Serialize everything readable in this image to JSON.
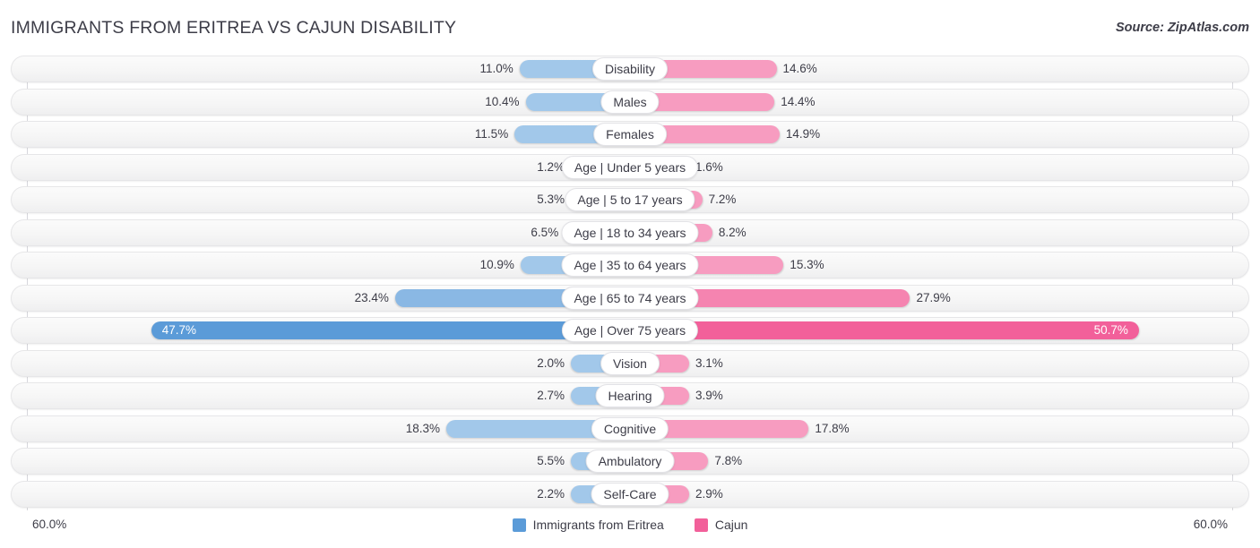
{
  "header": {
    "title": "IMMIGRANTS FROM ERITREA VS CAJUN DISABILITY",
    "source": "Source: ZipAtlas.com"
  },
  "axis": {
    "left_label": "60.0%",
    "right_label": "60.0%"
  },
  "legend": {
    "items": [
      {
        "label": "Immigrants from Eritrea",
        "color": "#5b9bd8"
      },
      {
        "label": "Cajun",
        "color": "#f2609a"
      }
    ]
  },
  "colors": {
    "blue_light": "#a2c8ea",
    "blue_mid": "#8ab8e4",
    "blue_dark": "#5b9bd8",
    "pink_light": "#f79cc0",
    "pink_mid": "#f584b0",
    "pink_dark": "#f2609a",
    "track": "#f6f6f6",
    "gridline": "#d7d7dc"
  },
  "chart_data": {
    "type": "bar",
    "subtype": "diverging-bidirectional",
    "title": "IMMIGRANTS FROM ERITREA VS CAJUN DISABILITY",
    "xlabel": "",
    "ylabel": "",
    "xlim": [
      60.0,
      60.0
    ],
    "axis_max_percent": 60.0,
    "grid": true,
    "legend_position": "bottom-center",
    "categories": [
      "Disability",
      "Males",
      "Females",
      "Age | Under 5 years",
      "Age | 5 to 17 years",
      "Age | 18 to 34 years",
      "Age | 35 to 64 years",
      "Age | 65 to 74 years",
      "Age | Over 75 years",
      "Vision",
      "Hearing",
      "Cognitive",
      "Ambulatory",
      "Self-Care"
    ],
    "series": [
      {
        "name": "Immigrants from Eritrea",
        "color": "#5b9bd8",
        "values": [
          11.0,
          10.4,
          11.5,
          1.2,
          5.3,
          6.5,
          10.9,
          23.4,
          47.7,
          2.0,
          2.7,
          18.3,
          5.5,
          2.2
        ],
        "labels": [
          "11.0%",
          "10.4%",
          "11.5%",
          "1.2%",
          "5.3%",
          "6.5%",
          "10.9%",
          "23.4%",
          "47.7%",
          "2.0%",
          "2.7%",
          "18.3%",
          "5.5%",
          "2.2%"
        ]
      },
      {
        "name": "Cajun",
        "color": "#f2609a",
        "values": [
          14.6,
          14.4,
          14.9,
          1.6,
          7.2,
          8.2,
          15.3,
          27.9,
          50.7,
          3.1,
          3.9,
          17.8,
          7.8,
          2.9
        ],
        "labels": [
          "14.6%",
          "14.4%",
          "14.9%",
          "1.6%",
          "7.2%",
          "8.2%",
          "15.3%",
          "27.9%",
          "50.7%",
          "3.1%",
          "3.9%",
          "17.8%",
          "7.8%",
          "2.9%"
        ]
      }
    ]
  }
}
